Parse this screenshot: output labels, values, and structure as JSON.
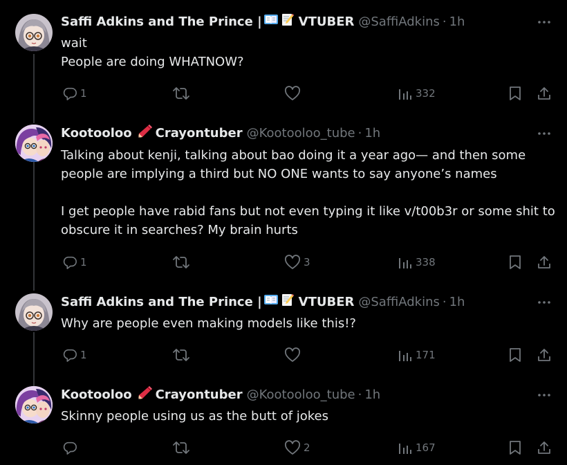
{
  "tweets": [
    {
      "name_parts": [
        "Saffi Adkins and The Prince |",
        "VTUBER"
      ],
      "emoji_set": "book-memo",
      "handle": "@SaffiAdkins",
      "time": "1h",
      "text": "wait\nPeople are doing WHATNOW?",
      "replies": "1",
      "retweets": "",
      "likes": "",
      "views": "332"
    },
    {
      "name_parts": [
        "Kootooloo",
        "Crayontuber"
      ],
      "emoji_set": "pencil",
      "handle": "@Kootooloo_tube",
      "time": "1h",
      "text": "Talking about kenji, talking about bao doing it a year ago— and then some people are implying a third but NO ONE wants to say anyone’s names\n\nI get people have rabid fans but not even typing it like v/t00b3r or some shit to obscure it in searches? My brain hurts",
      "replies": "1",
      "retweets": "",
      "likes": "3",
      "views": "338"
    },
    {
      "name_parts": [
        "Saffi Adkins and The Prince |",
        "VTUBER"
      ],
      "emoji_set": "book-memo",
      "handle": "@SaffiAdkins",
      "time": "1h",
      "text": "Why are people even making models like this!?",
      "replies": "1",
      "retweets": "",
      "likes": "",
      "views": "171"
    },
    {
      "name_parts": [
        "Kootooloo",
        "Crayontuber"
      ],
      "emoji_set": "pencil",
      "handle": "@Kootooloo_tube",
      "time": "1h",
      "text": "Skinny people using us as the butt of jokes",
      "replies": "",
      "retweets": "",
      "likes": "2",
      "views": "167"
    }
  ],
  "separator_dot": "·",
  "colors": {
    "background": "#000000",
    "text": "#e7e9ea",
    "muted": "#71767b",
    "thread_line": "#333639"
  },
  "icons": [
    "reply-icon",
    "retweet-icon",
    "like-icon",
    "views-icon",
    "bookmark-icon",
    "share-icon",
    "more-icon"
  ]
}
